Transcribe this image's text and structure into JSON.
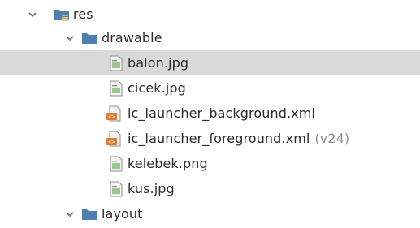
{
  "tree": {
    "res": {
      "label": "res",
      "icon": "resource-folder-icon"
    },
    "drawable": {
      "label": "drawable",
      "icon": "folder-icon"
    },
    "files": [
      {
        "label": "balon.jpg",
        "icon": "image-file-icon",
        "selected": true
      },
      {
        "label": "cicek.jpg",
        "icon": "image-file-icon"
      },
      {
        "label": "ic_launcher_background.xml",
        "icon": "xml-file-icon"
      },
      {
        "label": "ic_launcher_foreground.xml",
        "icon": "xml-file-icon",
        "suffix": "(v24)"
      },
      {
        "label": "kelebek.png",
        "icon": "image-file-icon"
      },
      {
        "label": "kus.jpg",
        "icon": "image-file-icon"
      }
    ],
    "layout": {
      "label": "layout",
      "icon": "folder-icon"
    }
  },
  "colors": {
    "selection_bg": "#d9d9d9",
    "folder_blue": "#4f7fb0",
    "xml_orange": "#e07b2f",
    "image_icon_gray": "#8d8d8d",
    "suffix_gray": "#8c8c8c"
  }
}
